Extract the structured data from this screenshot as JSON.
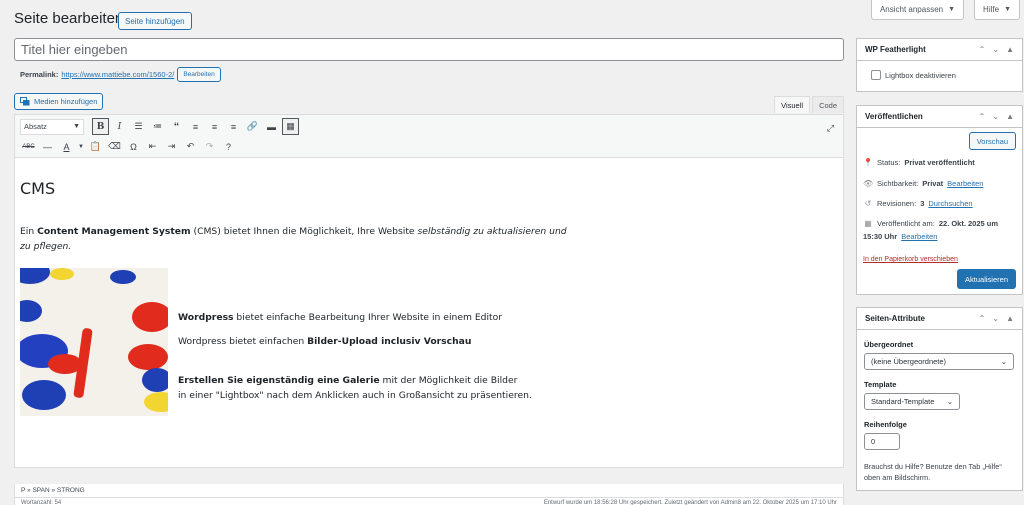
{
  "header": {
    "title": "Seite bearbeiten",
    "add_new": "Seite hinzufügen",
    "screen_options": "Ansicht anpassen",
    "help": "Hilfe"
  },
  "editor": {
    "title_placeholder": "Titel hier eingeben",
    "permalink_label": "Permalink:",
    "permalink_url": "https://www.mattiebe.com/1560-2/",
    "permalink_edit": "Bearbeiten",
    "add_media": "Medien hinzufügen",
    "tab_visual": "Visuell",
    "tab_code": "Code",
    "format_select": "Absatz",
    "content": {
      "heading": "CMS",
      "intro_pre": "Ein ",
      "intro_bold": "Content Management System",
      "intro_mid": " (CMS) bietet Ihnen die Möglichkeit, Ihre Website ",
      "intro_em": "selbständig zu aktualisieren und zu pflegen.",
      "f1_bold": "Wordpress",
      "f1_rest": " bietet einfache Bearbeitung Ihrer Website in einem Editor",
      "f2_pre": "Wordpress bietet einfachen ",
      "f2_bold": "Bilder-Upload inclusiv Vorschau",
      "f3_bold": "Erstellen Sie eigenständig eine Galerie",
      "f3_rest": " mit der Möglichkeit die Bilder",
      "f4": "in einer \"Lightbox\" nach dem Anklicken auch in Großansicht zu präsentieren."
    },
    "path": "P » SPAN » STRONG",
    "word_count": "Wortanzahl: 54",
    "draft_status": "Entwurf wurde um 18:56:28 Uhr gespeichert. Zuletzt geändert von Admin8 am 22. Oktober 2025 um 17:10 Uhr"
  },
  "featherlight": {
    "title": "WP Featherlight",
    "checkbox_label": "Lightbox deaktivieren"
  },
  "publish": {
    "title": "Veröffentlichen",
    "preview": "Vorschau",
    "status_label": "Status:",
    "status_value": "Privat veröffentlicht",
    "visibility_label": "Sichtbarkeit:",
    "visibility_value": "Privat",
    "visibility_edit": "Bearbeiten",
    "revisions_label": "Revisionen:",
    "revisions_value": "3",
    "revisions_link": "Durchsuchen",
    "published_label": "Veröffentlicht am:",
    "published_value": "22. Okt. 2025 um",
    "published_time": "15:30 Uhr",
    "published_edit": "Bearbeiten",
    "trash": "In den Papierkorb verschieben",
    "update": "Aktualisieren"
  },
  "attributes": {
    "title": "Seiten-Attribute",
    "parent_label": "Übergeordnet",
    "parent_value": "(keine Übergeordnete)",
    "template_label": "Template",
    "template_value": "Standard-Template",
    "order_label": "Reihenfolge",
    "order_value": "0",
    "help_text": "Brauchst du Hilfe? Benutze den Tab „Hilfe“ oben am Bildschirm."
  }
}
